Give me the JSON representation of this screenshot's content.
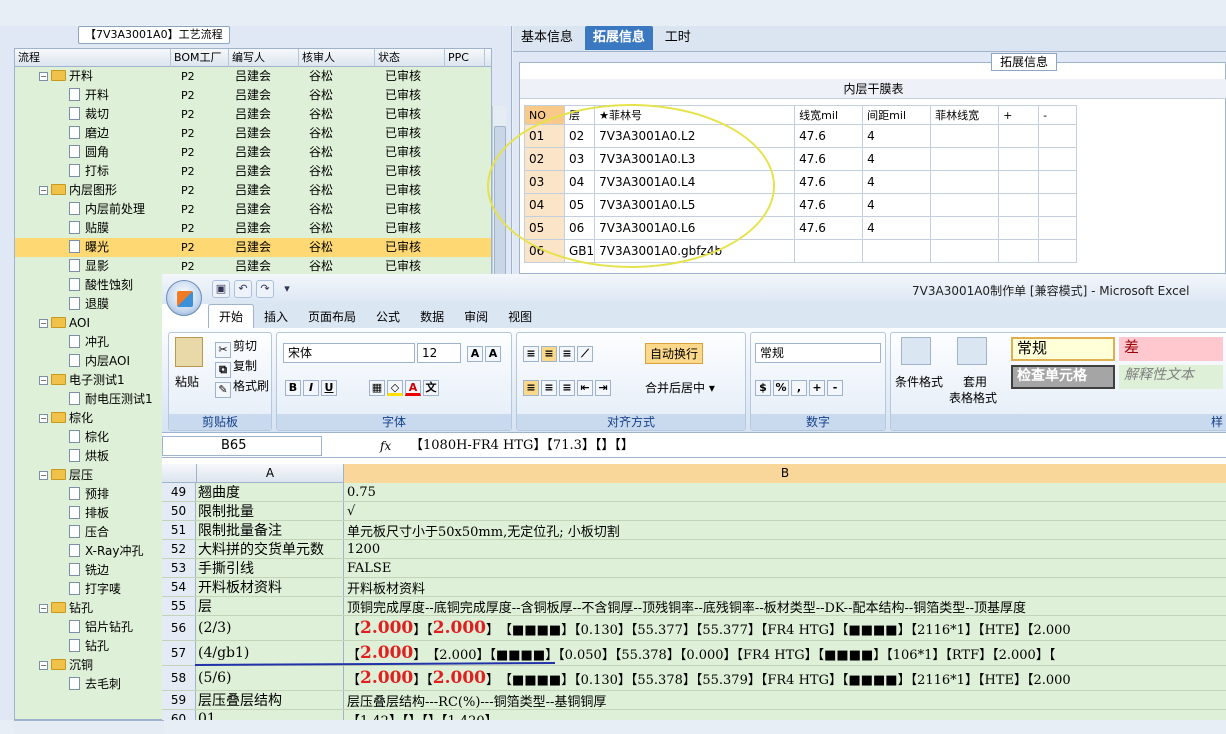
{
  "left_panel": {
    "title": "【7V3A3001A0】工艺流程",
    "columns": [
      "流程",
      "BOM工厂",
      "编写人",
      "核审人",
      "状态",
      "PPC"
    ],
    "rows": [
      {
        "type": "folder",
        "name": "开料",
        "bom": "P2",
        "writer": "吕建会",
        "reviewer": "谷松",
        "status": "已审核"
      },
      {
        "type": "item",
        "name": "开料",
        "bom": "P2",
        "writer": "吕建会",
        "reviewer": "谷松",
        "status": "已审核"
      },
      {
        "type": "item",
        "name": "裁切",
        "bom": "P2",
        "writer": "吕建会",
        "reviewer": "谷松",
        "status": "已审核"
      },
      {
        "type": "item",
        "name": "磨边",
        "bom": "P2",
        "writer": "吕建会",
        "reviewer": "谷松",
        "status": "已审核"
      },
      {
        "type": "item",
        "name": "圆角",
        "bom": "P2",
        "writer": "吕建会",
        "reviewer": "谷松",
        "status": "已审核"
      },
      {
        "type": "item",
        "name": "打标",
        "bom": "P2",
        "writer": "吕建会",
        "reviewer": "谷松",
        "status": "已审核"
      },
      {
        "type": "folder",
        "name": "内层图形",
        "bom": "P2",
        "writer": "吕建会",
        "reviewer": "谷松",
        "status": "已审核"
      },
      {
        "type": "item",
        "name": "内层前处理",
        "bom": "P2",
        "writer": "吕建会",
        "reviewer": "谷松",
        "status": "已审核"
      },
      {
        "type": "item",
        "name": "贴膜",
        "bom": "P2",
        "writer": "吕建会",
        "reviewer": "谷松",
        "status": "已审核"
      },
      {
        "type": "item",
        "name": "曝光",
        "bom": "P2",
        "writer": "吕建会",
        "reviewer": "谷松",
        "status": "已审核",
        "selected": true
      },
      {
        "type": "item",
        "name": "显影",
        "bom": "P2",
        "writer": "吕建会",
        "reviewer": "谷松",
        "status": "已审核"
      },
      {
        "type": "item",
        "name": "酸性蚀刻"
      },
      {
        "type": "item",
        "name": "退膜"
      },
      {
        "type": "folder",
        "name": "AOI"
      },
      {
        "type": "item",
        "name": "冲孔"
      },
      {
        "type": "item",
        "name": "内层AOI"
      },
      {
        "type": "folder",
        "name": "电子测试1"
      },
      {
        "type": "item",
        "name": "耐电压测试1"
      },
      {
        "type": "folder",
        "name": "棕化"
      },
      {
        "type": "item",
        "name": "棕化"
      },
      {
        "type": "item",
        "name": "烘板"
      },
      {
        "type": "folder",
        "name": "层压"
      },
      {
        "type": "item",
        "name": "预排"
      },
      {
        "type": "item",
        "name": "排板"
      },
      {
        "type": "item",
        "name": "压合"
      },
      {
        "type": "item",
        "name": "X-Ray冲孔"
      },
      {
        "type": "item",
        "name": "铣边"
      },
      {
        "type": "item",
        "name": "打字唛"
      },
      {
        "type": "folder",
        "name": "钻孔"
      },
      {
        "type": "item",
        "name": "铝片钻孔"
      },
      {
        "type": "item",
        "name": "钻孔"
      },
      {
        "type": "folder",
        "name": "沉铜"
      },
      {
        "type": "item",
        "name": "去毛刺"
      }
    ]
  },
  "right_panel": {
    "tabs": [
      "基本信息",
      "拓展信息",
      "工时"
    ],
    "active_tab": "拓展信息",
    "group_label": "拓展信息",
    "grid_title": "内层干膜表",
    "columns": [
      "NO",
      "层",
      "★菲林号",
      "线宽mil",
      "间距mil",
      "菲林线宽",
      "+",
      "-"
    ],
    "rows": [
      [
        "01",
        "02",
        "7V3A3001A0.L2",
        "47.6",
        "4",
        "",
        "",
        ""
      ],
      [
        "02",
        "03",
        "7V3A3001A0.L3",
        "47.6",
        "4",
        "",
        "",
        ""
      ],
      [
        "03",
        "04",
        "7V3A3001A0.L4",
        "47.6",
        "4",
        "",
        "",
        ""
      ],
      [
        "04",
        "05",
        "7V3A3001A0.L5",
        "47.6",
        "4",
        "",
        "",
        ""
      ],
      [
        "05",
        "06",
        "7V3A3001A0.L6",
        "47.6",
        "4",
        "",
        "",
        ""
      ],
      [
        "06",
        "GB1",
        "7V3A3001A0.gbfz4b",
        "",
        "",
        "",
        "",
        ""
      ]
    ]
  },
  "excel": {
    "caption": "7V3A3001A0制作单 [兼容模式] - Microsoft Excel",
    "ribbon_tabs": [
      "开始",
      "插入",
      "页面布局",
      "公式",
      "数据",
      "审阅",
      "视图"
    ],
    "clipboard": {
      "paste": "粘贴",
      "cut": "剪切",
      "copy": "复制",
      "format_painter": "格式刷",
      "label": "剪贴板"
    },
    "font": {
      "name": "宋体",
      "size": "12",
      "label": "字体"
    },
    "alignment": {
      "wrap": "自动换行",
      "merge": "合并后居中",
      "label": "对齐方式"
    },
    "number": {
      "format": "常规",
      "label": "数字"
    },
    "styles": {
      "cond": "条件格式",
      "table1": "套用",
      "table2": "表格格式",
      "normal": "常规",
      "bad": "差",
      "check": "检查单元格",
      "explain": "解释性文本",
      "label": "样"
    },
    "name_box": "B65",
    "fx": "fx",
    "formula": "【1080H-FR4 HTG】【71.3】【】【】",
    "col_a": "A",
    "col_b": "B",
    "rows": [
      {
        "n": "49",
        "a": "翘曲度",
        "b": "0.75"
      },
      {
        "n": "50",
        "a": "限制批量",
        "b": "√"
      },
      {
        "n": "51",
        "a": "限制批量备注",
        "b": "单元板尺寸小于50x50mm,无定位孔; 小板切割"
      },
      {
        "n": "52",
        "a": "大料拼的交货单元数",
        "b": "1200"
      },
      {
        "n": "53",
        "a": "手撕引线",
        "b": "FALSE"
      },
      {
        "n": "54",
        "a": "开料板材资料",
        "b": "开料板材资料"
      },
      {
        "n": "55",
        "a": "层",
        "b": "顶铜完成厚度--底铜完成厚度--含铜板厚--不含铜厚--顶残铜率--底残铜率--板材类型--DK--配本结构--铜箔类型--顶基厚度"
      },
      {
        "n": "56",
        "a": "(2/3)",
        "tall": true,
        "r1": "2.000",
        "r2": "2.000",
        "rest": "【■■■■】【0.130】【55.377】【55.377】【FR4 HTG】【■■■■】【2116*1】【HTE】【2.000"
      },
      {
        "n": "57",
        "a": "(4/gb1)",
        "tall": true,
        "r1": "2.000",
        "r2": "",
        "rest": "【2.000】【■■■■】【0.050】【55.378】【0.000】【FR4 HTG】【■■■■】【106*1】【RTF】【2.000】【"
      },
      {
        "n": "58",
        "a": "(5/6)",
        "tall": true,
        "r1": "2.000",
        "r2": "2.000",
        "rest": "【■■■■】【0.130】【55.378】【55.379】【FR4 HTG】【■■■■】【2116*1】【HTE】【2.000"
      },
      {
        "n": "59",
        "a": "层压叠层结构",
        "b": "层压叠层结构---RC(%)---铜箔类型--基铜铜厚"
      },
      {
        "n": "60",
        "a": "01",
        "b": "【1.42】【】【】【1.420】"
      }
    ]
  },
  "colors": {
    "selected_row": "#fdd873",
    "active_tab": "#3b78c2",
    "sheet_bg": "#dff0d8",
    "highlight": "#e6e24a"
  }
}
